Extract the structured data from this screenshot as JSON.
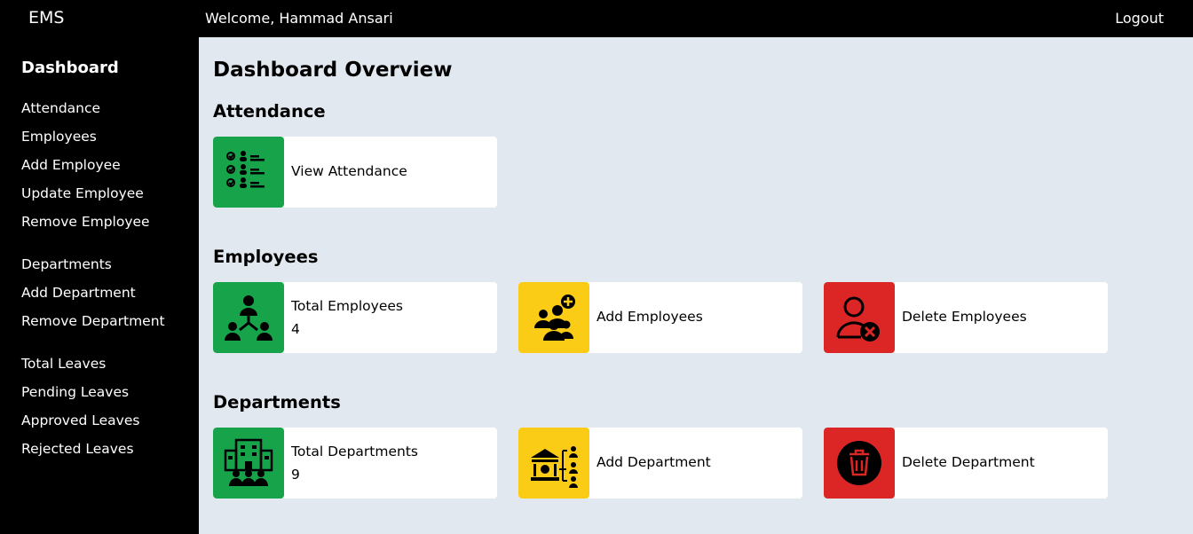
{
  "header": {
    "brand": "EMS",
    "welcome": "Welcome, Hammad Ansari",
    "logout": "Logout"
  },
  "sidebar": {
    "title": "Dashboard",
    "items": [
      {
        "label": "Attendance"
      },
      {
        "label": "Employees"
      },
      {
        "label": "Add Employee"
      },
      {
        "label": "Update Employee"
      },
      {
        "label": "Remove Employee"
      },
      {
        "label": "Departments"
      },
      {
        "label": "Add Department"
      },
      {
        "label": "Remove Department"
      },
      {
        "label": "Total Leaves"
      },
      {
        "label": "Pending Leaves"
      },
      {
        "label": "Approved Leaves"
      },
      {
        "label": "Rejected Leaves"
      }
    ]
  },
  "main": {
    "title": "Dashboard Overview",
    "sections": {
      "attendance": {
        "title": "Attendance",
        "cards": [
          {
            "label": "View Attendance",
            "icon": "attendance-checklist-icon",
            "color": "#16a34a"
          }
        ]
      },
      "employees": {
        "title": "Employees",
        "cards": [
          {
            "label": "Total Employees",
            "value": "4",
            "icon": "org-chart-icon",
            "color": "#16a34a"
          },
          {
            "label": "Add Employees",
            "icon": "add-group-icon",
            "color": "#facc15"
          },
          {
            "label": "Delete Employees",
            "icon": "delete-user-icon",
            "color": "#dc2626"
          }
        ]
      },
      "departments": {
        "title": "Departments",
        "cards": [
          {
            "label": "Total Departments",
            "value": "9",
            "icon": "building-people-icon",
            "color": "#16a34a"
          },
          {
            "label": "Add Department",
            "icon": "institution-people-icon",
            "color": "#facc15"
          },
          {
            "label": "Delete Department",
            "icon": "trash-icon",
            "color": "#dc2626"
          }
        ]
      }
    }
  }
}
